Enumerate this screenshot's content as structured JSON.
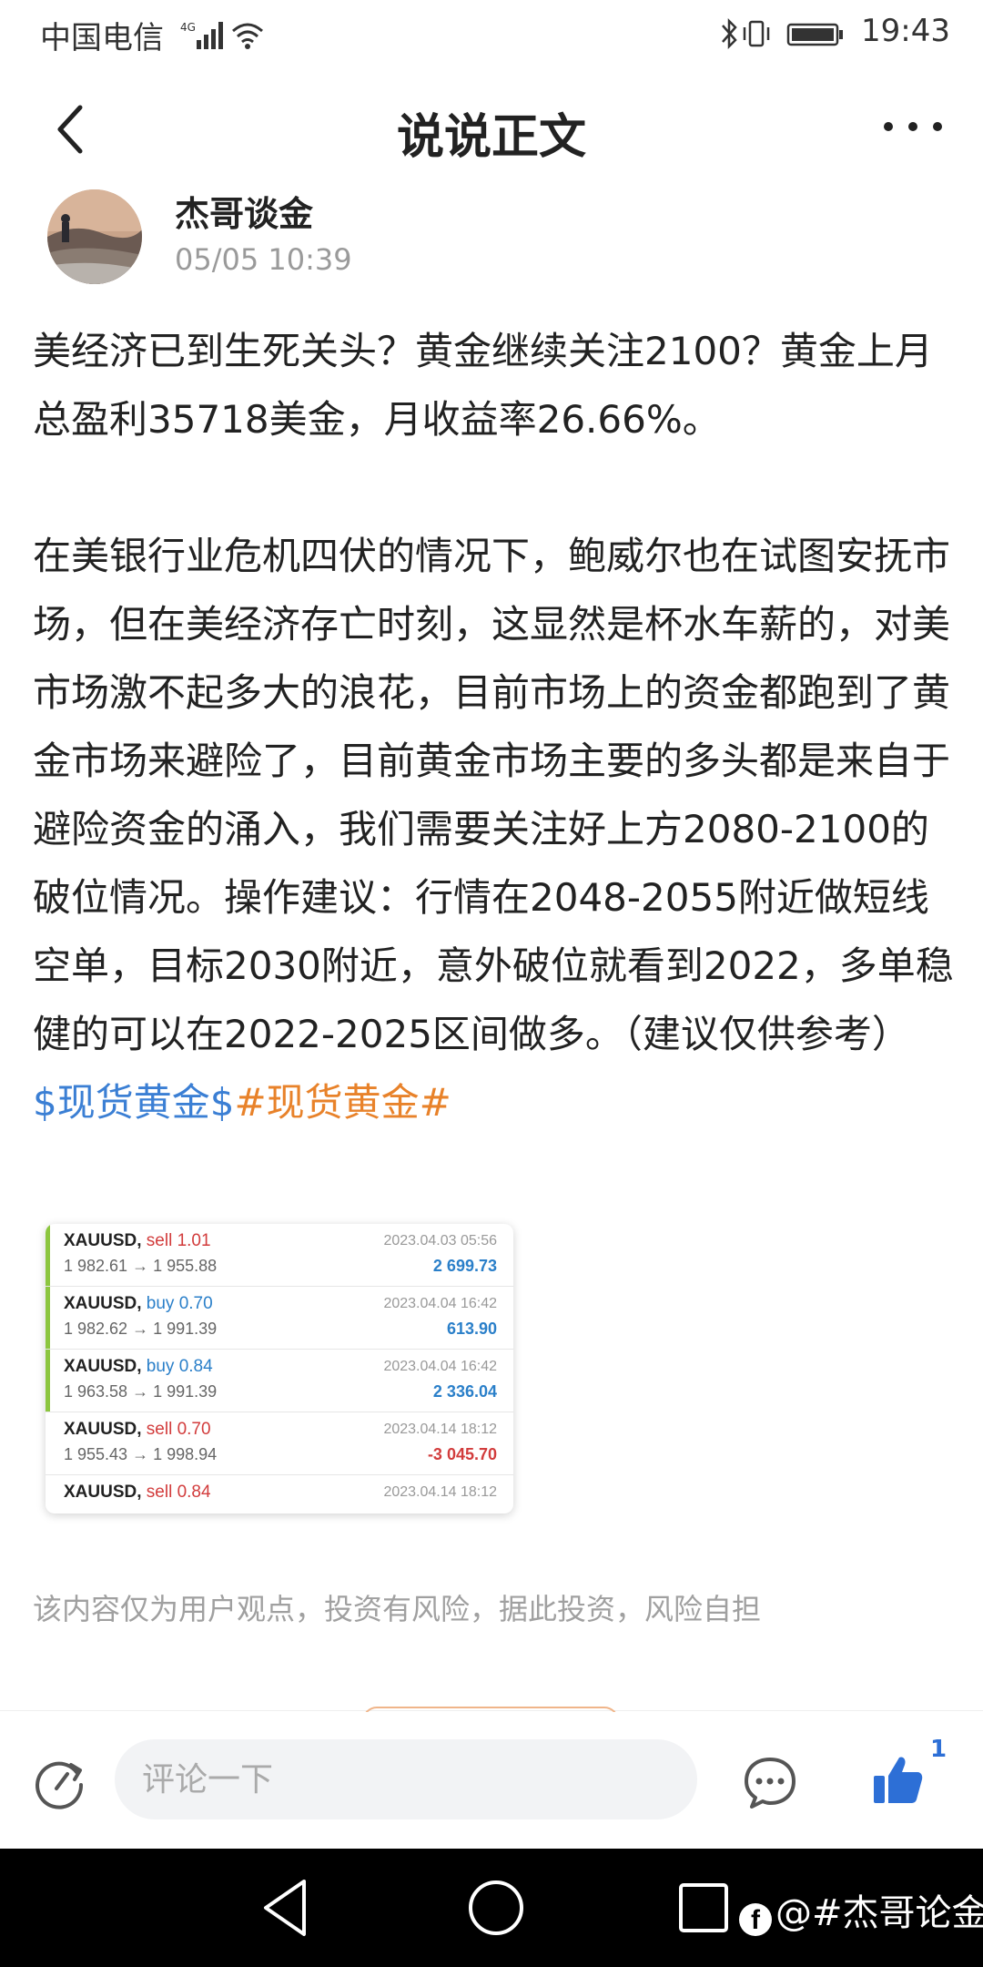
{
  "status_bar": {
    "carrier": "中国电信",
    "network": "4G",
    "time": "19:43",
    "icons": [
      "signal-icon",
      "wifi-icon",
      "bluetooth-icon",
      "vibrate-icon",
      "battery-icon"
    ]
  },
  "header": {
    "title": "说说正文",
    "back_icon": "back-arrow-icon",
    "more_icon": "more-dots-icon"
  },
  "author": {
    "name": "杰哥谈金",
    "time": "05/05 10:39"
  },
  "post": {
    "paragraph1": "美经济已到生死关头？黄金继续关注2100？黄金上月总盈利35718美金，月收益率26.66%。",
    "paragraph2": "在美银行业危机四伏的情况下，鲍威尔也在试图安抚市场，但在美经济存亡时刻，这显然是杯水车薪的，对美市场激不起多大的浪花，目前市场上的资金都跑到了黄金市场来避险了，目前黄金市场主要的多头都是来自于避险资金的涌入，我们需要关注好上方2080-2100的破位情况。操作建议：行情在2048-2055附近做短线空单，目标2030附近，意外破位就看到2022，多单稳健的可以在2022-2025区间做多。（建议仅供参考）",
    "tag_stock": "$现货黄金$",
    "tag_topic": "#现货黄金#"
  },
  "trades": [
    {
      "symbol": "XAUUSD,",
      "side": "sell 1.01",
      "side_color": "#d23c3c",
      "prices": "1 982.61 → 1 955.88",
      "date": "2023.04.03 05:56",
      "pnl": "2 699.73",
      "pnl_color": "#2a7fc9",
      "bar_color": "#8cc63f"
    },
    {
      "symbol": "XAUUSD,",
      "side": "buy 0.70",
      "side_color": "#2a7fc9",
      "prices": "1 982.62 → 1 991.39",
      "date": "2023.04.04 16:42",
      "pnl": "613.90",
      "pnl_color": "#2a7fc9",
      "bar_color": "#8cc63f"
    },
    {
      "symbol": "XAUUSD,",
      "side": "buy 0.84",
      "side_color": "#2a7fc9",
      "prices": "1 963.58 → 1 991.39",
      "date": "2023.04.04 16:42",
      "pnl": "2 336.04",
      "pnl_color": "#2a7fc9",
      "bar_color": "#8cc63f"
    },
    {
      "symbol": "XAUUSD,",
      "side": "sell 0.70",
      "side_color": "#d23c3c",
      "prices": "1 955.43 → 1 998.94",
      "date": "2023.04.14 18:12",
      "pnl": "-3 045.70",
      "pnl_color": "#d23c3c",
      "bar_color": "#ffffff"
    },
    {
      "symbol": "XAUUSD,",
      "side": "sell 0.84",
      "side_color": "#d23c3c",
      "prices": "",
      "date": "2023.04.14 18:12",
      "pnl": "",
      "pnl_color": "#d23c3c",
      "bar_color": "#ffffff"
    }
  ],
  "disclaimer": "该内容仅为用户观点，投资有风险，据此投资，风险自担",
  "comment_bar": {
    "placeholder": "评论一下",
    "like_count": "1"
  },
  "nav_bar": {
    "watermark": "@#杰哥论金"
  },
  "colors": {
    "tag_blue": "#3b7fd4",
    "tag_orange": "#e8822a",
    "like_blue": "#2d6fd6"
  }
}
